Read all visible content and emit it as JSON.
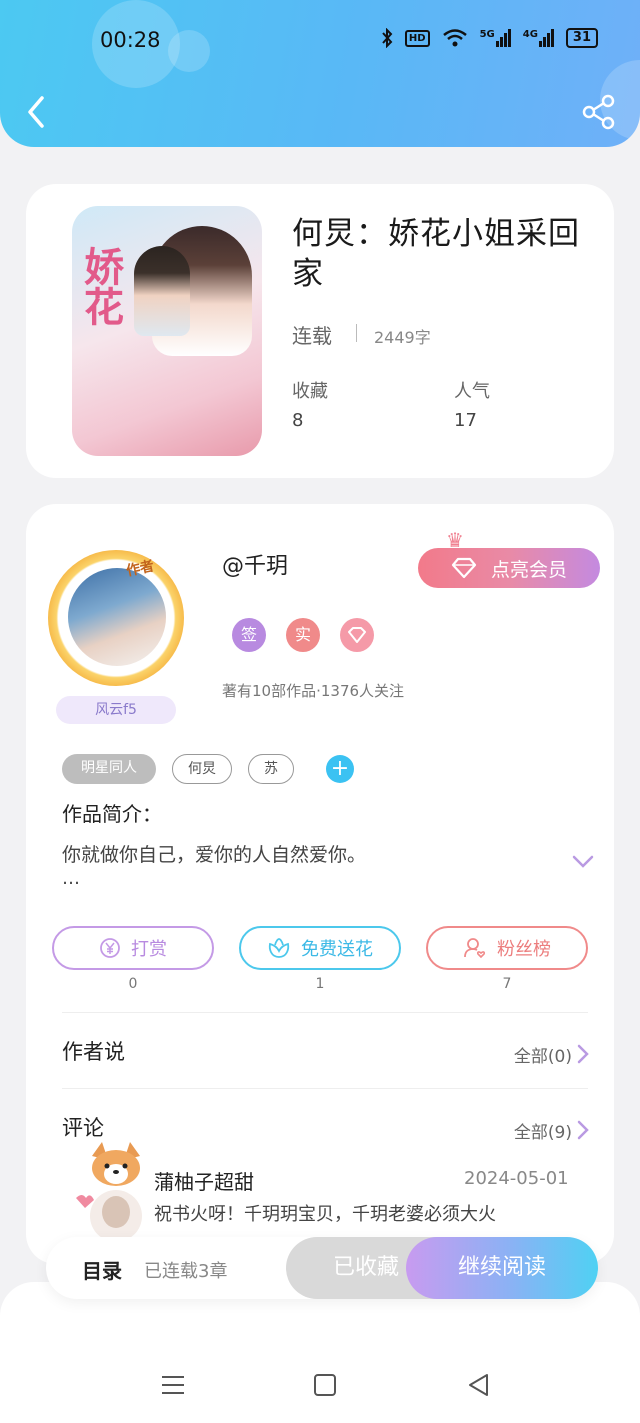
{
  "status_bar": {
    "time": "00:28",
    "icons": [
      "bluetooth-icon",
      "hd-icon",
      "wifi-icon",
      "5g-signal-icon",
      "4g-signal-icon"
    ],
    "network_5g": "5G",
    "network_4g": "4G",
    "hd": "HD",
    "battery": "31"
  },
  "header": {
    "back_icon": "back-arrow-icon",
    "share_icon": "share-icon",
    "colors": {
      "start": "#4cc9f2",
      "end": "#6fb0f8"
    }
  },
  "book": {
    "title": "何炅：娇花小姐采回家",
    "cover_text": "娇花",
    "status": "连载",
    "word_count": "2449字",
    "collect_label": "收藏",
    "collect_value": "8",
    "popularity_label": "人气",
    "popularity_value": "17"
  },
  "author": {
    "name": "@千玥",
    "avatar_tag": "作者",
    "rank_badge": "风云f5",
    "vip_button": "点亮会员",
    "badges": [
      {
        "label": "签",
        "color": "#b88ae0"
      },
      {
        "label": "实",
        "color": "#f08a8a"
      },
      {
        "label": "diamond-icon",
        "color": "#f59aa8"
      }
    ],
    "stats": "著有10部作品·1376人关注"
  },
  "tags": [
    "明星同人",
    "何炅",
    "苏"
  ],
  "intro": {
    "label": "作品简介：",
    "text": "你就做你自己，爱你的人自然爱你。",
    "more": "…"
  },
  "actions": [
    {
      "label": "打赏",
      "icon": "yen-icon",
      "count": "0",
      "color": "#c49ae6"
    },
    {
      "label": "免费送花",
      "icon": "flower-icon",
      "count": "1",
      "color": "#4cc8ec"
    },
    {
      "label": "粉丝榜",
      "icon": "fan-user-icon",
      "count": "7",
      "color": "#f08a8a"
    }
  ],
  "author_says": {
    "title": "作者说",
    "all": "全部(0)"
  },
  "comments": {
    "title": "评论",
    "all": "全部(9)",
    "items": [
      {
        "user": "蒲柚子超甜",
        "date": "2024-05-01",
        "text": "祝书火呀！千玥玥宝贝，千玥老婆必须大火"
      }
    ]
  },
  "bottom_bar": {
    "toc": "目录",
    "toc_sub": "已连载3章",
    "collected": "已收藏",
    "continue": "继续阅读"
  },
  "nav_bar": {
    "icons": [
      "menu-icon",
      "home-square-icon",
      "back-triangle-icon"
    ]
  }
}
